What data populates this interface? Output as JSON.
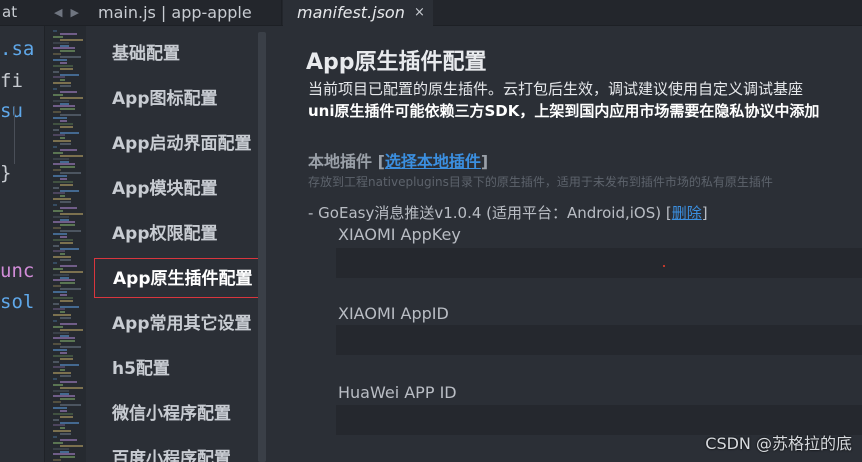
{
  "tabs": {
    "left_fragment": "at",
    "nav_back": "◀",
    "nav_forward": "▶",
    "main_tab": "main.js | app-apple",
    "active_tab": "manifest.json",
    "close_glyph": "×"
  },
  "code": {
    "lines": [
      {
        "text": ".sa",
        "color": "#5fa8ea"
      },
      {
        "text": " fi",
        "color": "#c8ccd2"
      },
      {
        "text": " su",
        "color": "#5fa8ea"
      },
      {
        "text": " }",
        "color": "#c8ccd2"
      },
      {
        "text": "unc",
        "color": "#d18cd8"
      },
      {
        "text": "sol",
        "color": "#5fa8ea"
      }
    ]
  },
  "sidebar": {
    "items": [
      {
        "label": "基础配置"
      },
      {
        "label": "App图标配置"
      },
      {
        "label": "App启动界面配置"
      },
      {
        "label": "App模块配置"
      },
      {
        "label": "App权限配置"
      },
      {
        "label": "App原生插件配置",
        "selected": true
      },
      {
        "label": "App常用其它设置"
      },
      {
        "label": "h5配置"
      },
      {
        "label": "微信小程序配置"
      },
      {
        "label": "百度小程序配置"
      }
    ]
  },
  "main": {
    "title": "App原生插件配置",
    "desc1": "当前项目已配置的原生插件。云打包后生效，调试建议使用自定义调试基座",
    "desc2": "uni原生插件可能依赖三方SDK，上架到国内应用市场需要在隐私协议中添加",
    "local_section": {
      "label": "本地插件 ",
      "bracket_open": "[",
      "link": "选择本地插件",
      "bracket_close": "]",
      "hint": "存放到工程nativeplugins目录下的原生插件，适用于未发布到插件市场的私有原生插件"
    },
    "plugin": {
      "text": "- GoEasy消息推送v1.0.4 (适用平台：Android,iOS) ",
      "bracket_open": "[",
      "delete_link": "删除",
      "bracket_close": "]"
    },
    "fields": [
      {
        "label": "XIAOMI AppKey",
        "value": ""
      },
      {
        "label": "XIAOMI AppID",
        "value": ""
      },
      {
        "label": "HuaWei APP ID",
        "value": ""
      }
    ]
  },
  "watermark": "CSDN @苏格拉的底",
  "colors": {
    "background": "#2b2f36",
    "link": "#3b8fe0",
    "selected_border": "#d9363e"
  }
}
